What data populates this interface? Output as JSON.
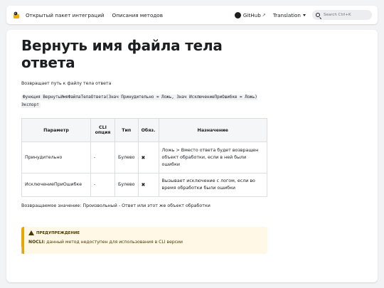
{
  "navbar": {
    "links": [
      "Открытый пакет интеграций",
      "Описания методов"
    ],
    "github": "GitHub",
    "translation": "Translation",
    "search_placeholder": "Search Ctrl+K"
  },
  "page": {
    "title": "Вернуть имя файла тела ответа",
    "description": "Возвращает путь к файлу тела ответа",
    "signature": "Функция ВернутьИмяФайлаТелаОтвета(Знач Принудительно = Ложь, Знач ИсключениеПриОшибке = Ложь) Экспорт",
    "table": {
      "headers": [
        "Параметр",
        "CLI опция",
        "Тип",
        "Обяз.",
        "Назначение"
      ],
      "rows": [
        [
          "Принудительно",
          "-",
          "Булево",
          "✖",
          "Ложь > Вместо ответа будет возвращен объект обработки, если в ней были ошибки"
        ],
        [
          "ИсключениеПриОшибке",
          "-",
          "Булево",
          "✖",
          "Вызывает исключение с логом, если во время обработки были ошибки"
        ]
      ]
    },
    "return_value": "Возвращаемое значение: Произвольный - Ответ или этот же объект обработки",
    "warning": {
      "title": "ПРЕДУПРЕЖДЕНИЕ",
      "label": "NOCLI:",
      "text": " данный метод недоступен для использования в CLI версии"
    }
  },
  "colors": {
    "accent_warning": "#e6a700",
    "warning_bg": "#fff8e6"
  }
}
